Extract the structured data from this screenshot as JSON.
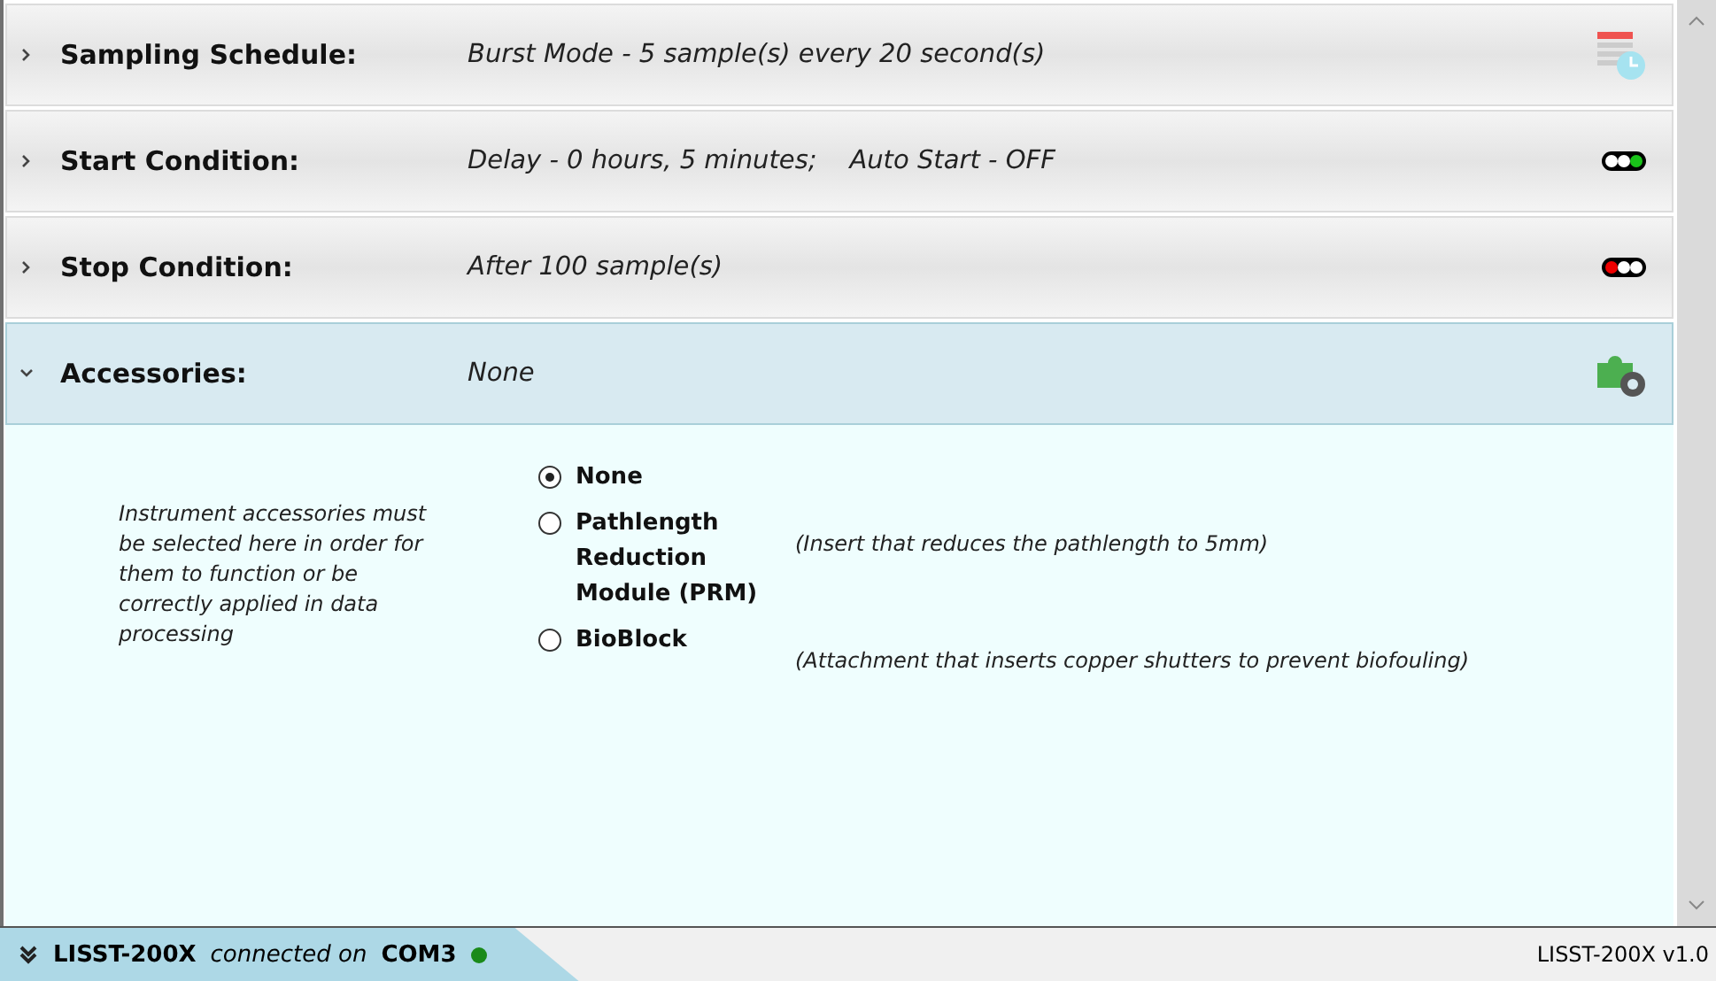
{
  "sections": [
    {
      "label": "Sampling Schedule:",
      "summary": "Burst Mode - 5 sample(s) every 20 second(s)",
      "expanded": false,
      "kind": "schedule"
    },
    {
      "label": "Start Condition:",
      "summary": "Delay - 0 hours, 5 minutes;    Auto Start - OFF",
      "expanded": false,
      "kind": "light-green"
    },
    {
      "label": "Stop Condition:",
      "summary": "After 100 sample(s)",
      "expanded": false,
      "kind": "light-red"
    },
    {
      "label": "Accessories:",
      "summary": "None",
      "expanded": true,
      "kind": "accessory"
    }
  ],
  "accessories": {
    "help": "Instrument accessories must be selected here in order for them to function or be correctly applied in data processing",
    "options": [
      {
        "label": "None",
        "selected": true
      },
      {
        "label": "Pathlength Reduction Module (PRM)",
        "selected": false,
        "note": "(Insert that reduces the pathlength to 5mm)"
      },
      {
        "label": "BioBlock",
        "selected": false,
        "note": "(Attachment that inserts copper shutters to prevent biofouling)"
      }
    ]
  },
  "status_bar": {
    "device": "LISST-200X",
    "connected_text": "connected on",
    "port": "COM3",
    "connected": true,
    "version": "LISST-200X v1.0"
  }
}
